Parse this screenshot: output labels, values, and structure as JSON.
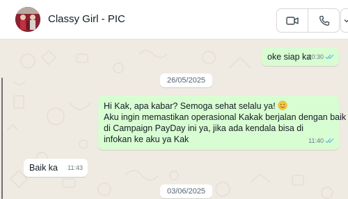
{
  "header": {
    "contact_name": "Classy Girl - PIC",
    "avatar_icon": "profile-photo",
    "video_call_icon": "video-camera-icon",
    "voice_call_icon": "phone-icon"
  },
  "messages": [
    {
      "id": "m1",
      "direction": "outgoing",
      "text": "oke siap ka",
      "time": "20:30",
      "status": "read"
    },
    {
      "id": "d1",
      "type": "date",
      "text": "26/05/2025"
    },
    {
      "id": "m2",
      "direction": "outgoing",
      "lines": [
        "Hi Kak, apa kabar? Semoga sehat selalu ya!",
        "Aku ingin memastikan operasional Kakak berjalan dengan baik",
        "di Campaign PayDay ini ya, jika ada kendala bisa di",
        "infokan ke aku ya Kak"
      ],
      "emoji": "smiling-face-icon",
      "time": "11:40",
      "status": "read"
    },
    {
      "id": "m3",
      "direction": "incoming",
      "text": "Baik ka",
      "time": "11:43"
    },
    {
      "id": "d2",
      "type": "date",
      "text": "03/06/2025"
    }
  ],
  "colors": {
    "outgoing_bubble": "#d9fdd3",
    "incoming_bubble": "#ffffff",
    "chat_background": "#efeae2",
    "read_tick": "#53bdeb"
  }
}
